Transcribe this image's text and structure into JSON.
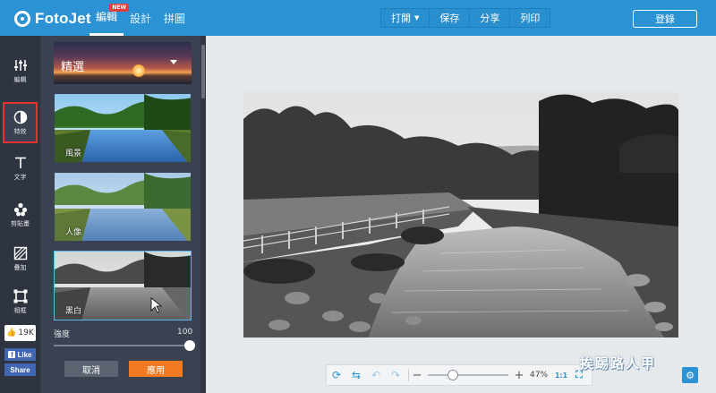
{
  "app": {
    "logo_text": "FotoJet"
  },
  "nav": {
    "items": [
      {
        "label": "編輯",
        "active": true,
        "badge": "NEW"
      },
      {
        "label": "設計",
        "active": false
      },
      {
        "label": "拼圖",
        "active": false
      }
    ]
  },
  "toolbar": {
    "open_label": "打開",
    "save_label": "保存",
    "share_label": "分享",
    "print_label": "列印"
  },
  "login_label": "登錄",
  "sidebar": {
    "items": [
      {
        "label": "編輯",
        "icon": "sliders-icon"
      },
      {
        "label": "特效",
        "icon": "contrast-icon",
        "active": true
      },
      {
        "label": "文字",
        "icon": "text-icon"
      },
      {
        "label": "剪貼畫",
        "icon": "clipart-icon"
      },
      {
        "label": "疊加",
        "icon": "overlay-icon"
      },
      {
        "label": "相框",
        "icon": "frame-icon"
      }
    ],
    "like_count": "19K",
    "like_label": "Like",
    "share_label": "Share"
  },
  "effects": {
    "category": "精選",
    "thumbnails": [
      {
        "label": "風景",
        "selected": false
      },
      {
        "label": "人像",
        "selected": false
      },
      {
        "label": "黑白",
        "selected": true
      }
    ],
    "intensity_label": "強度",
    "intensity_value": "100",
    "intensity_fraction": 1.0,
    "cancel_label": "取消",
    "apply_label": "應用"
  },
  "zoom": {
    "percent": "47%",
    "fit_label": "1:1"
  },
  "watermark": "挨踢路人甲",
  "colors": {
    "topbar": "#2b93d4",
    "sidebar": "#2e3440",
    "panel": "#3a4150",
    "apply": "#f17b20",
    "highlight": "#e23232"
  }
}
